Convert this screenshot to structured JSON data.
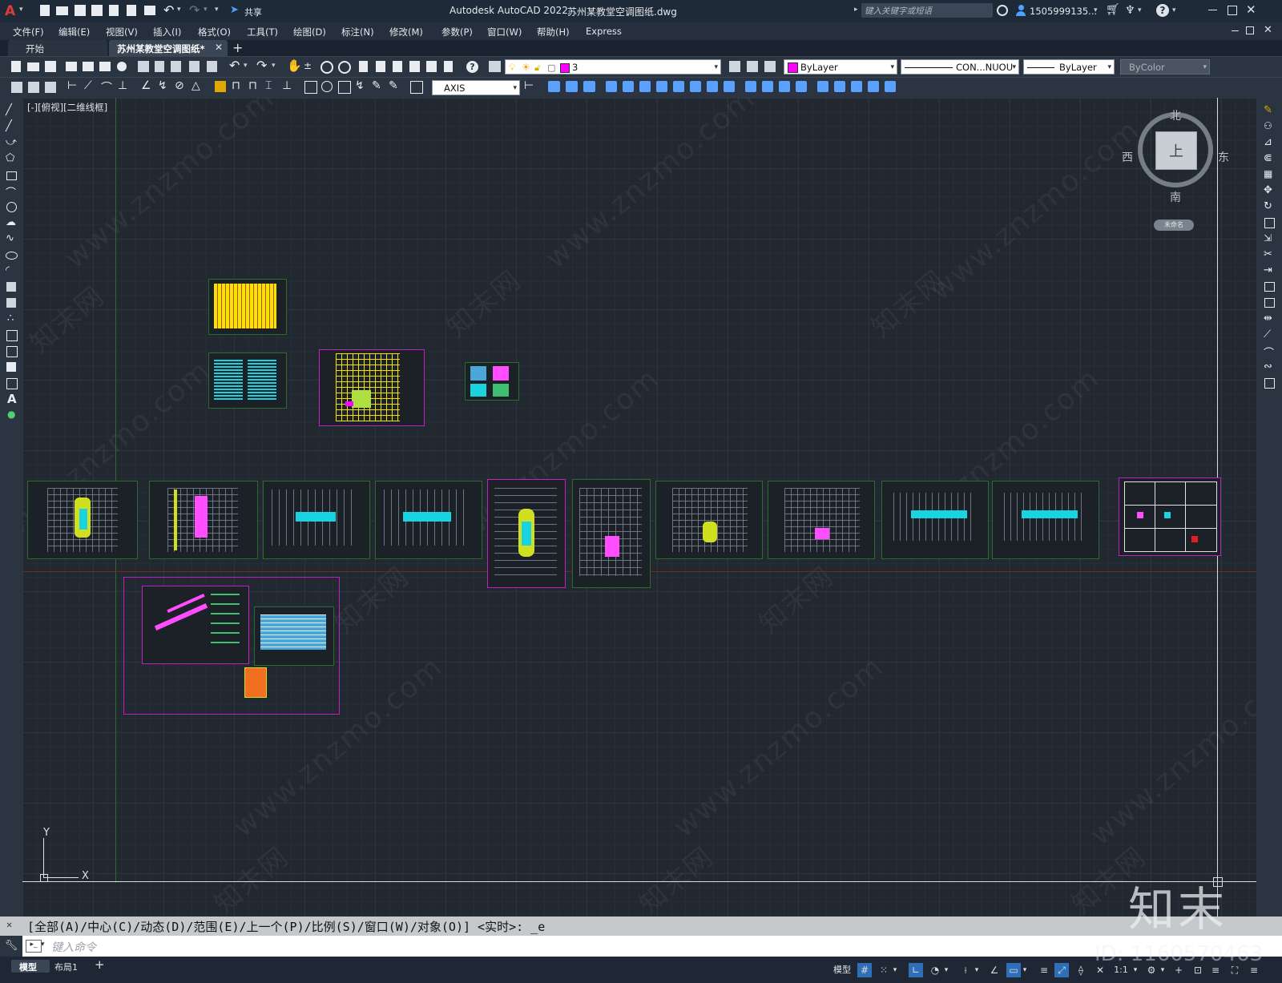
{
  "app": {
    "title": "Autodesk AutoCAD 2022",
    "document": "苏州某教堂空调图纸.dwg",
    "search_placeholder": "键入关键字或短语",
    "user": "1505999135...",
    "share_label": "共享"
  },
  "menu": [
    "文件(F)",
    "编辑(E)",
    "视图(V)",
    "插入(I)",
    "格式(O)",
    "工具(T)",
    "绘图(D)",
    "标注(N)",
    "修改(M)",
    "参数(P)",
    "窗口(W)",
    "帮助(H)",
    "Express"
  ],
  "tabs": [
    {
      "label": "开始",
      "active": false
    },
    {
      "label": "苏州某教堂空调图纸*",
      "active": true
    }
  ],
  "toolbar": {
    "layer_value": "3",
    "color_value": "ByLayer",
    "linetype_value": "CON...NUOU",
    "lineweight_value": "ByLayer",
    "plotstyle_value": "ByColor",
    "dimstyle_value": "AXIS"
  },
  "viewport_label": "[-][俯视][二维线框]",
  "viewcube": {
    "north": "北",
    "south": "南",
    "east": "东",
    "west": "西",
    "face": "上",
    "ucs_label": "未命名"
  },
  "ucs": {
    "x": "X",
    "y": "Y"
  },
  "command": {
    "history": "[全部(A)/中心(C)/动态(D)/范围(E)/上一个(P)/比例(S)/窗口(W)/对象(O)] <实时>: _e",
    "placeholder": "键入命令"
  },
  "layout_tabs": [
    "模型",
    "布局1"
  ],
  "status": {
    "model_label": "模型",
    "scale": "1:1"
  },
  "watermark": {
    "site": "www.znzmo.com",
    "brand": "知末网",
    "logo": "知末",
    "id": "ID: 1160570463"
  },
  "colors": {
    "accent": "#ff00ff",
    "grid": "#2c3540",
    "sheet_border": "#2b6b2b"
  }
}
